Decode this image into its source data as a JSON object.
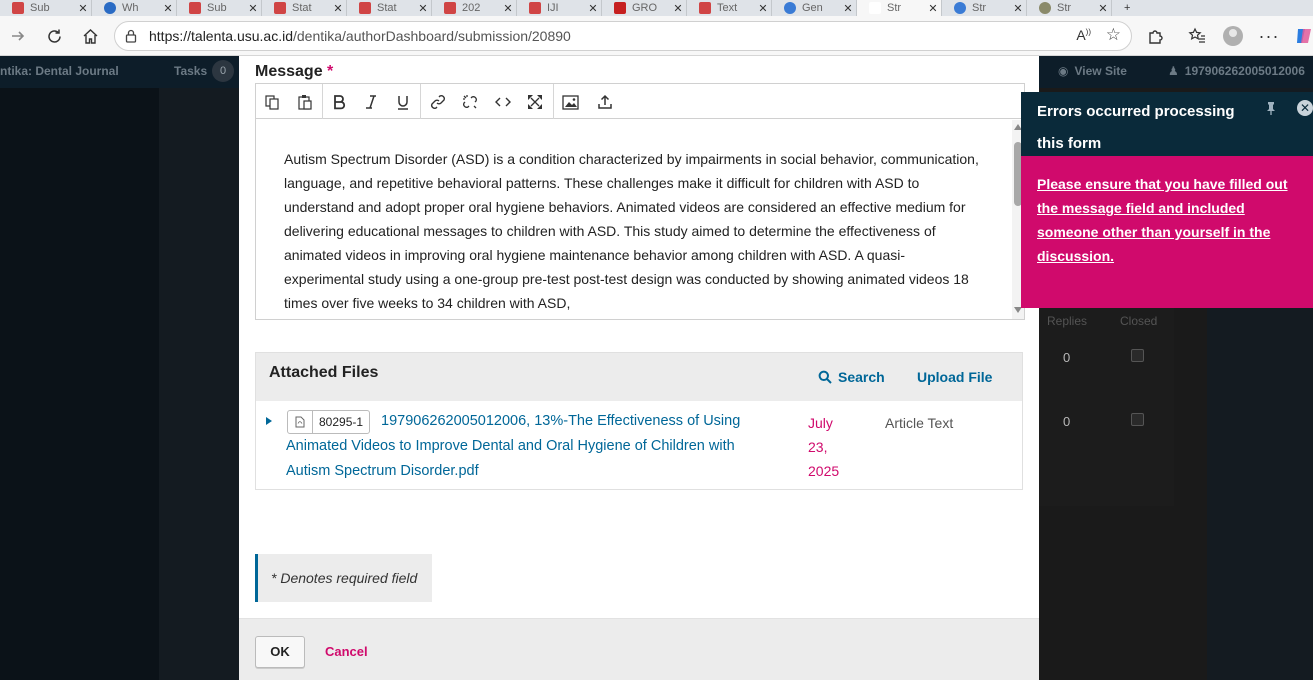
{
  "browser": {
    "tabs": [
      {
        "title": "Sub",
        "favicon_color": "#d04545"
      },
      {
        "title": "Wh",
        "favicon_color": "#2a6bc4"
      },
      {
        "title": "Sub",
        "favicon_color": "#d04545"
      },
      {
        "title": "Stat",
        "favicon_color": "#d04545"
      },
      {
        "title": "Stat",
        "favicon_color": "#d04545"
      },
      {
        "title": "202",
        "favicon_color": "#d04545"
      },
      {
        "title": "IJI",
        "favicon_color": "#d04545"
      },
      {
        "title": "GRO",
        "favicon_color": "#c62020"
      },
      {
        "title": "Text",
        "favicon_color": "#d04545"
      },
      {
        "title": "Gen",
        "favicon_color": "#3a7bd5"
      },
      {
        "title": "Str",
        "favicon_color": "#ffffff"
      },
      {
        "title": "Str",
        "favicon_color": "#3a7bd5"
      },
      {
        "title": "Str",
        "favicon_color": "#8a8a6a"
      }
    ],
    "url_host": "https://talenta.usu.ac.id",
    "url_path": "/dentika/authorDashboard/submission/20890"
  },
  "ojs": {
    "site_name": "ntika: Dental Journal",
    "tasks_label": "Tasks",
    "tasks_count": "0",
    "view_site": "View Site",
    "username": "197906262005012006",
    "table_headers": [
      "Replies",
      "Closed"
    ],
    "replies": [
      "0",
      "0"
    ]
  },
  "modal": {
    "message_label": "Message",
    "required_mark": "*",
    "message_text": "Autism Spectrum Disorder (ASD) is a condition characterized by impairments in social behavior, communication, language, and repetitive behavioral patterns. These challenges make it difficult for children with ASD to understand and adopt proper oral hygiene behaviors. Animated videos are considered an effective medium for delivering educational messages to children with ASD. This study aimed to determine the effectiveness of animated videos in improving oral hygiene maintenance behavior among children with ASD. A quasi-experimental study using a one-group pre-test post-test design was conducted by showing animated videos 18 times over five weeks to 34 children with ASD,",
    "attached_files_title": "Attached Files",
    "search_label": "Search",
    "upload_label": "Upload File",
    "file": {
      "id": "80295-1",
      "name": "197906262005012006, 13%-The Effectiveness of Using Animated Videos to Improve Dental and Oral Hygiene of Children with Autism Spectrum Disorder.pdf",
      "date": "July 23, 2025",
      "type": "Article Text"
    },
    "required_note": "* Denotes required field",
    "ok_label": "OK",
    "cancel_label": "Cancel"
  },
  "error": {
    "title": "Errors occurred processing this form",
    "message": "Please ensure that you have filled out the message field and included someone other than yourself in the discussion."
  },
  "colors": {
    "link": "#006798",
    "accent": "#d00a6c",
    "error_header": "#0a2a3a"
  }
}
